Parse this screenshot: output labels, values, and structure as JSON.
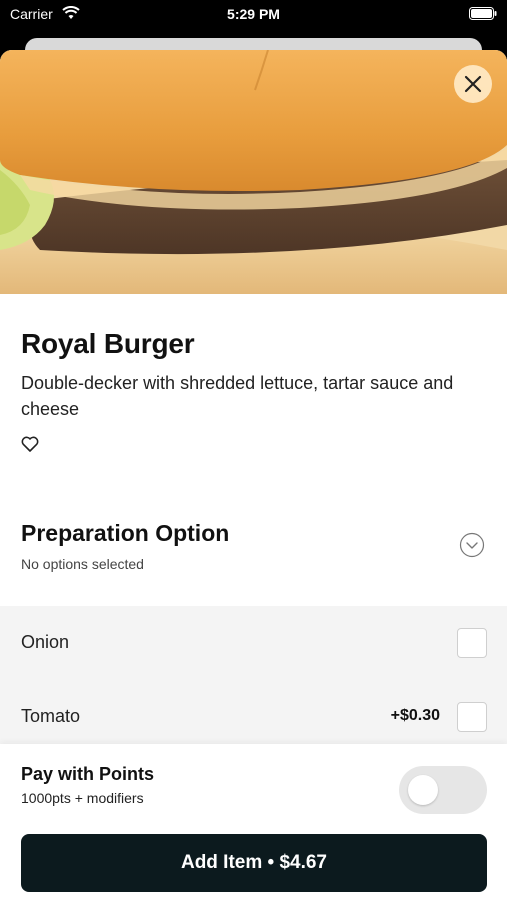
{
  "status_bar": {
    "carrier": "Carrier",
    "time": "5:29 PM",
    "icons": [
      "wifi-icon",
      "battery-icon"
    ]
  },
  "item": {
    "title": "Royal Burger",
    "description": "Double-decker with shredded lettuce, tartar sauce and cheese",
    "favorite_icon": "heart-outline-icon"
  },
  "preparation": {
    "title": "Preparation Option",
    "subtitle": "No options selected",
    "icon": "chevron-down-icon",
    "options": [
      {
        "label": "Onion",
        "price": "",
        "checked": false
      },
      {
        "label": "Tomato",
        "price": "+$0.30",
        "checked": false
      }
    ]
  },
  "points": {
    "title": "Pay with Points",
    "subtitle": "1000pts + modifiers",
    "enabled": false
  },
  "add_button": {
    "label": "Add Item • $4.67"
  },
  "colors": {
    "button_bg": "#0c1a1e",
    "options_bg": "#f4f4f4",
    "toggle_bg": "#e6e6e6",
    "close_button_bg": "#ffebc8"
  }
}
